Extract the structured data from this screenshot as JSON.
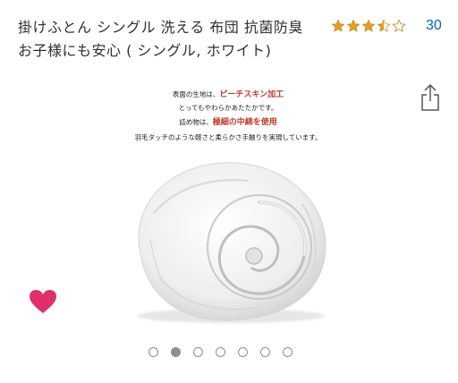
{
  "product": {
    "title": "掛けふとん シングル 洗える 布団 抗菌防臭 お子様にも安心 ( シングル, ホワイト)"
  },
  "rating": {
    "stars": 3.5,
    "count": "30",
    "color": "#e4a11b"
  },
  "image_caption": {
    "line1_prefix": "表面の生地は、",
    "line1_highlight": "ピーチスキン加工",
    "line2": "とってもやわらかあたたかです。",
    "line3_prefix": "詰め物は、",
    "line3_highlight": "極細の中綿を使用",
    "line4": "羽毛タッチのような軽さと柔らかさ手触りを実現しています。"
  },
  "icons": {
    "share": "share-icon",
    "favorite": "heart-icon"
  },
  "favorite": {
    "color": "#e0306a"
  },
  "carousel": {
    "total": 7,
    "active_index": 1
  }
}
